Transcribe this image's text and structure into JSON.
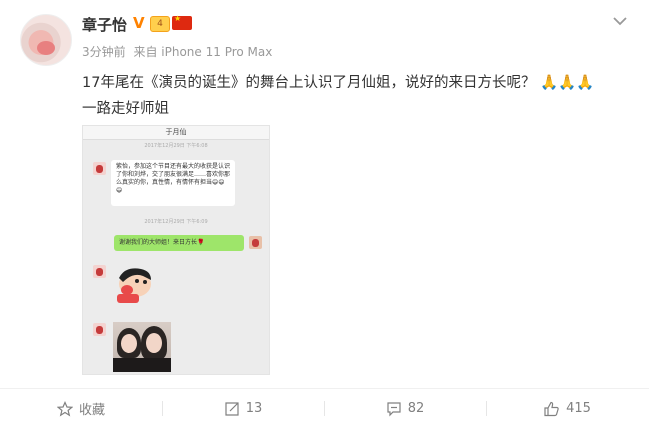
{
  "post": {
    "user_name": "章子怡",
    "level": "4",
    "meta": {
      "time": "3分钟前",
      "source": "来自 iPhone 11 Pro Max"
    },
    "text_line1": "17年尾在《演员的诞生》的舞台上认识了月仙姐，说好的来日方长呢？",
    "text_line2": "一路走好师姐",
    "pray_emoji": "🙏"
  },
  "screenshot": {
    "header_title": "于月仙",
    "timestamp1": "2017年12月29日 下午6:08",
    "message1": "紫怡，参加这个节目还有最大的收获是认识了你和刘烨，交了朋友很满足……喜欢你那么真实的你，真性情，有情怀有担当😄😄😄",
    "timestamp2": "2017年12月29日 下午6:09",
    "message2": "谢谢我们的大师姐！来日方长🌹"
  },
  "actions": {
    "favorite_label": "收藏",
    "repost_count": "13",
    "comment_count": "82",
    "like_count": "415"
  },
  "colors": {
    "accent": "#ff8200",
    "meta": "#999999",
    "action": "#808080"
  }
}
